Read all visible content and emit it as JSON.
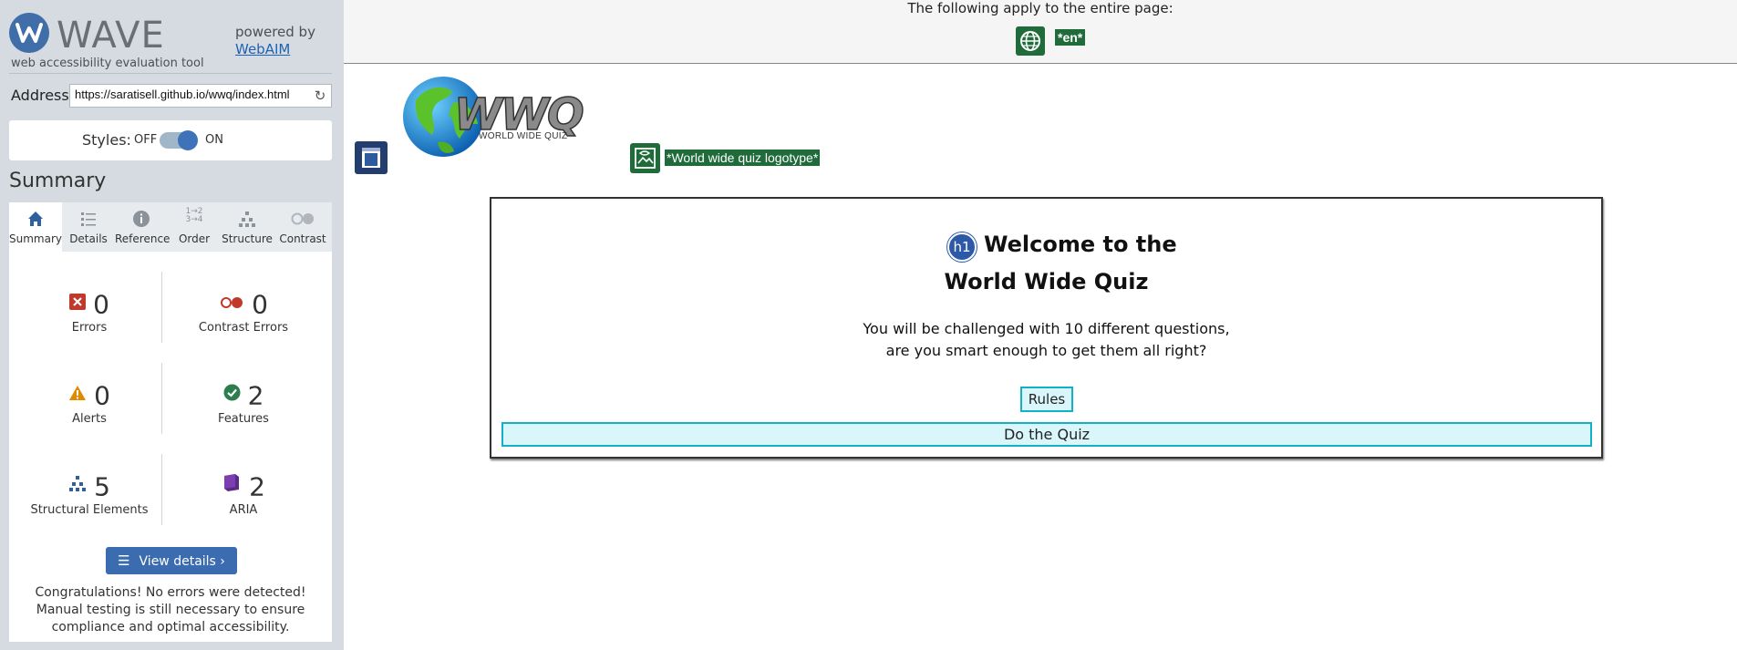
{
  "wave": {
    "name": "WAVE",
    "tagline": "web accessibility evaluation tool",
    "powered_by": "powered by",
    "webaim": "WebAIM"
  },
  "address": {
    "label": "Address:",
    "value": "https://saratisell.github.io/wwq/index.html",
    "refresh_icon": "refresh-icon"
  },
  "styles": {
    "label": "Styles:",
    "off": "OFF",
    "on": "ON",
    "state": "on"
  },
  "summary": {
    "heading": "Summary",
    "tabs": [
      {
        "label": "Summary",
        "icon": "home-icon",
        "active": true
      },
      {
        "label": "Details",
        "icon": "list-icon",
        "active": false
      },
      {
        "label": "Reference",
        "icon": "info-icon",
        "active": false
      },
      {
        "label": "Order",
        "icon": "order-icon",
        "active": false
      },
      {
        "label": "Structure",
        "icon": "structure-icon",
        "active": false
      },
      {
        "label": "Contrast",
        "icon": "contrast-icon",
        "active": false
      }
    ],
    "stats": {
      "errors": {
        "count": "0",
        "label": "Errors",
        "color": "#c0392b"
      },
      "contrast_errors": {
        "count": "0",
        "label": "Contrast Errors",
        "color": "#c0392b"
      },
      "alerts": {
        "count": "0",
        "label": "Alerts",
        "color": "#e08a00"
      },
      "features": {
        "count": "2",
        "label": "Features",
        "color": "#2e7d4f"
      },
      "structural": {
        "count": "5",
        "label": "Structural Elements",
        "color": "#2e5f9e"
      },
      "aria": {
        "count": "2",
        "label": "ARIA",
        "color": "#5b2a86"
      }
    },
    "view_details": "View details ›",
    "congrats": "Congratulations! No errors were detected! Manual testing is still necessary to ensure compliance and optimal accessibility."
  },
  "page": {
    "top_note": "The following apply to the entire page:",
    "lang_badge": "*en*",
    "logo_text": "WWQ",
    "logo_subtext": "WORLD WIDE QUIZ",
    "alt_badge": "*World wide quiz logotype*",
    "h1_badge": "h1",
    "title_line1": "Welcome to the",
    "title_line2": "World Wide Quiz",
    "desc_line1": "You will be challenged with 10 different questions,",
    "desc_line2": "are you smart enough to get them all right?",
    "rules_button": "Rules",
    "quiz_button": "Do the Quiz"
  },
  "colors": {
    "wave_blue": "#3b6cb0",
    "feature_green": "#1f6b3a",
    "aria_navy": "#233e6e",
    "button_cyan": "#12b1c8",
    "sidebar_bg": "#d5dbe0"
  }
}
